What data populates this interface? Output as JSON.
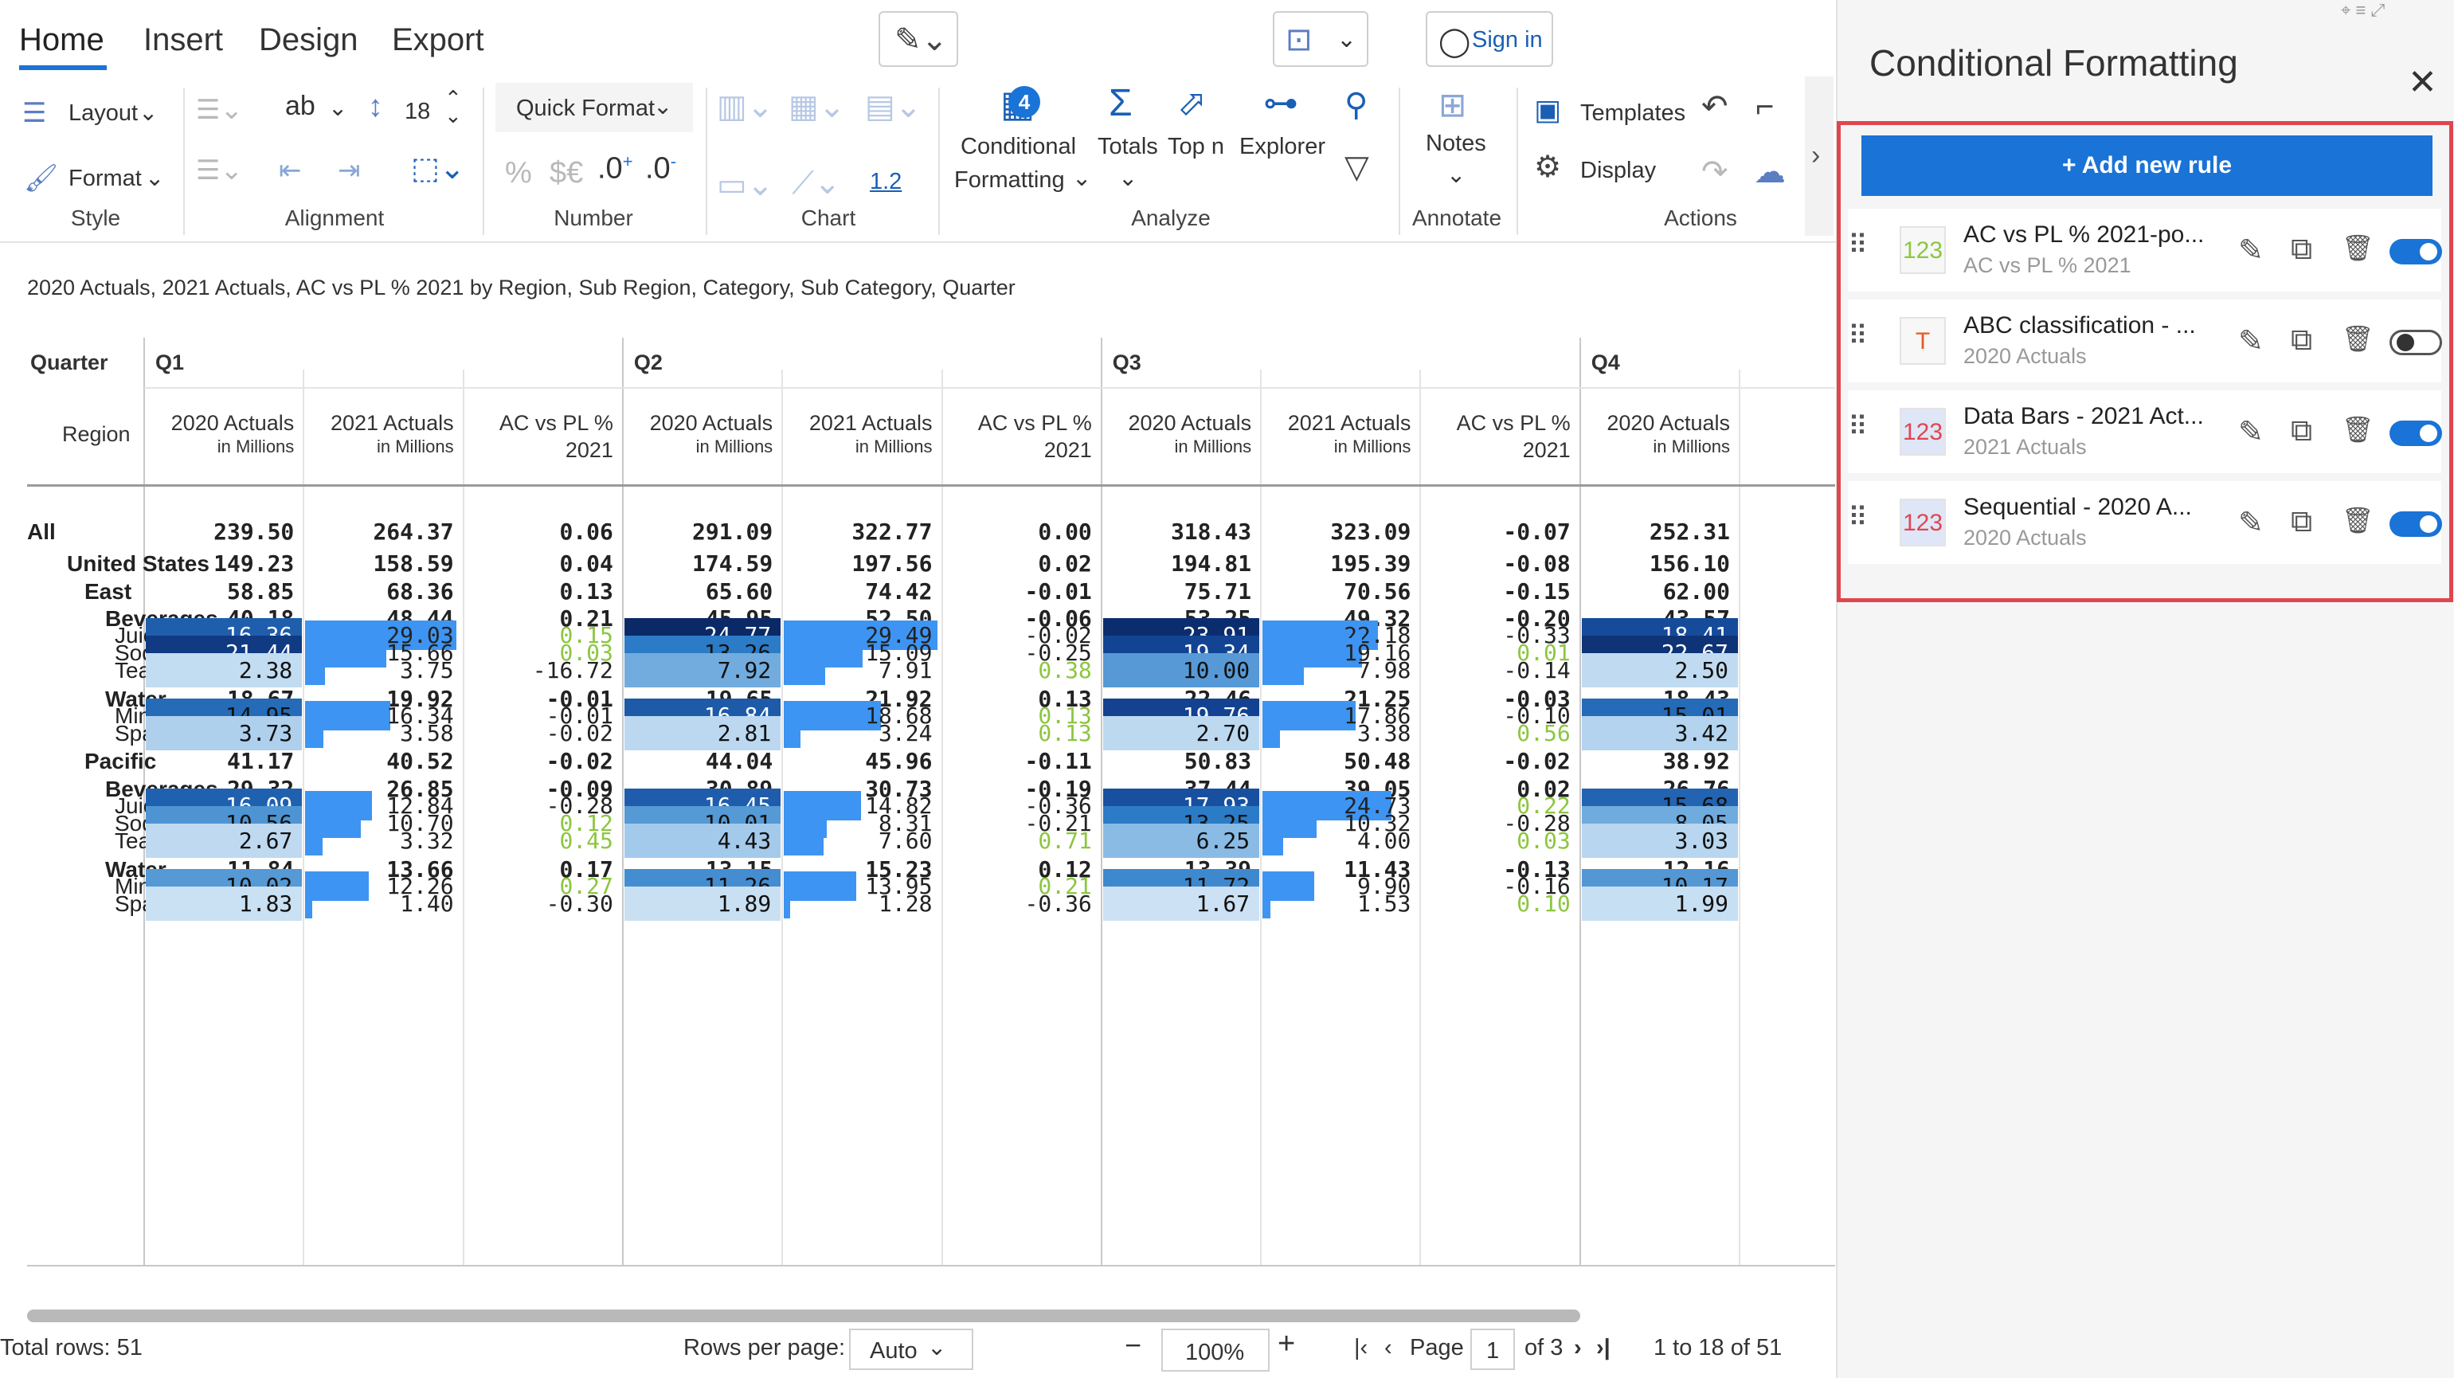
{
  "ribbon": {
    "tabs": [
      "Home",
      "Insert",
      "Design",
      "Export"
    ],
    "sign_in": "Sign in",
    "layout": "Layout",
    "format": "Format",
    "font_sample": "ab",
    "font_size": "18",
    "quick_format": "Quick Format",
    "decimal": "1.2",
    "conditional_formatting": [
      "Conditional",
      "Formatting"
    ],
    "cf_count": "4",
    "totals": "Totals",
    "topn": "Top n",
    "explorer": "Explorer",
    "notes": "Notes",
    "templates": "Templates",
    "display": "Display",
    "groups": [
      "Style",
      "Alignment",
      "Number",
      "Chart",
      "Analyze",
      "Annotate",
      "Actions"
    ]
  },
  "subtitle": "2020 Actuals, 2021 Actuals, AC vs PL % 2021 by Region, Sub Region, Category, Sub Category, Quarter",
  "table": {
    "corner_top": "Quarter",
    "corner_bottom": "Region",
    "quarters": [
      "Q1",
      "Q2",
      "Q3",
      "Q4"
    ],
    "measures": [
      [
        "2020 Actuals",
        "in Millions"
      ],
      [
        "2021 Actuals",
        "in Millions"
      ],
      [
        "AC vs PL %",
        "2021"
      ]
    ],
    "rows": [
      {
        "label": "All",
        "level": 0,
        "bold": true,
        "vals": [
          "239.50",
          "264.37",
          "0.06",
          "291.09",
          "322.77",
          "0.00",
          "318.43",
          "323.09",
          "-0.07",
          "252.31"
        ]
      },
      {
        "label": "United States",
        "level": 1,
        "bold": true,
        "vals": [
          "149.23",
          "158.59",
          "0.04",
          "174.59",
          "197.56",
          "0.02",
          "194.81",
          "195.39",
          "-0.08",
          "156.10"
        ]
      },
      {
        "label": "East",
        "level": 2,
        "bold": true,
        "vals": [
          "58.85",
          "68.36",
          "0.13",
          "65.60",
          "74.42",
          "-0.01",
          "75.71",
          "70.56",
          "-0.15",
          "62.00"
        ]
      },
      {
        "label": "Beverages",
        "level": 3,
        "bold": true,
        "vals": [
          "40.18",
          "48.44",
          "0.21",
          "45.95",
          "52.50",
          "-0.06",
          "53.25",
          "49.32",
          "-0.20",
          "43.57"
        ]
      },
      {
        "label": "Juices",
        "level": 4,
        "vals": [
          "16.36",
          "29.03",
          "0.15",
          "24.77",
          "29.49",
          "-0.02",
          "23.91",
          "22.18",
          "-0.33",
          "18.41"
        ]
      },
      {
        "label": "Soda",
        "level": 4,
        "vals": [
          "21.44",
          "15.66",
          "0.03",
          "13.26",
          "15.09",
          "-0.25",
          "19.34",
          "19.16",
          "0.01",
          "22.67"
        ]
      },
      {
        "label": "Tea & ...",
        "level": 4,
        "vals": [
          "2.38",
          "3.75",
          "-16.72",
          "7.92",
          "7.91",
          "0.38",
          "10.00",
          "7.98",
          "-0.14",
          "2.50"
        ]
      },
      {
        "label": "Water",
        "level": 3,
        "bold": true,
        "vals": [
          "18.67",
          "19.92",
          "-0.01",
          "19.65",
          "21.92",
          "0.13",
          "22.46",
          "21.25",
          "-0.03",
          "18.43"
        ]
      },
      {
        "label": "Mineral...",
        "level": 4,
        "vals": [
          "14.95",
          "16.34",
          "-0.01",
          "16.84",
          "18.68",
          "0.13",
          "19.76",
          "17.86",
          "-0.10",
          "15.01"
        ]
      },
      {
        "label": "Sparkli...",
        "level": 4,
        "vals": [
          "3.73",
          "3.58",
          "-0.02",
          "2.81",
          "3.24",
          "0.13",
          "2.70",
          "3.38",
          "0.56",
          "3.42"
        ]
      },
      {
        "label": "Pacific",
        "level": 2,
        "bold": true,
        "vals": [
          "41.17",
          "40.52",
          "-0.02",
          "44.04",
          "45.96",
          "-0.11",
          "50.83",
          "50.48",
          "-0.02",
          "38.92"
        ]
      },
      {
        "label": "Beverages",
        "level": 3,
        "bold": true,
        "vals": [
          "29.32",
          "26.85",
          "-0.09",
          "30.89",
          "30.73",
          "-0.19",
          "37.44",
          "39.05",
          "0.02",
          "26.76"
        ]
      },
      {
        "label": "Juices",
        "level": 4,
        "vals": [
          "16.09",
          "12.84",
          "-0.28",
          "16.45",
          "14.82",
          "-0.36",
          "17.93",
          "24.73",
          "0.22",
          "15.68"
        ]
      },
      {
        "label": "Soda",
        "level": 4,
        "vals": [
          "10.56",
          "10.70",
          "0.12",
          "10.01",
          "8.31",
          "-0.21",
          "13.25",
          "10.32",
          "-0.28",
          "8.05"
        ]
      },
      {
        "label": "Tea & ...",
        "level": 4,
        "vals": [
          "2.67",
          "3.32",
          "0.45",
          "4.43",
          "7.60",
          "0.71",
          "6.25",
          "4.00",
          "0.03",
          "3.03"
        ]
      },
      {
        "label": "Water",
        "level": 3,
        "bold": true,
        "vals": [
          "11.84",
          "13.66",
          "0.17",
          "13.15",
          "15.23",
          "0.12",
          "13.39",
          "11.43",
          "-0.13",
          "12.16"
        ]
      },
      {
        "label": "Mineral...",
        "level": 4,
        "vals": [
          "10.02",
          "12.26",
          "0.27",
          "11.26",
          "13.95",
          "0.21",
          "11.72",
          "9.90",
          "-0.16",
          "10.17"
        ]
      },
      {
        "label": "Sparkli...",
        "level": 4,
        "vals": [
          "1.83",
          "1.40",
          "-0.30",
          "1.89",
          "1.28",
          "-0.36",
          "1.67",
          "1.53",
          "0.10",
          "1.99"
        ]
      }
    ]
  },
  "footer": {
    "total_rows": "Total rows: 51",
    "rows_per_page_label": "Rows per page:",
    "rows_per_page": "Auto",
    "zoom": "100%",
    "page_label": "Page",
    "page": "1",
    "of_pages": "of 3",
    "range": "1 to 18 of 51"
  },
  "panel": {
    "title": "Conditional Formatting",
    "add_rule": "+ Add new rule",
    "rules": [
      {
        "badge": "123",
        "badge_color": "#8cc63f",
        "name": "AC vs PL % 2021-po...",
        "sub": "AC vs PL % 2021",
        "on": true
      },
      {
        "badge": "T",
        "badge_color": "#e85a1f",
        "name": "ABC classification - ...",
        "sub": "2020 Actuals",
        "on": false
      },
      {
        "badge": "123",
        "badge_color": "#e0464e",
        "name": "Data Bars - 2021 Act...",
        "sub": "2021 Actuals",
        "on": true
      },
      {
        "badge": "123",
        "badge_color": "#e0464e",
        "name": "Sequential - 2020 A...",
        "sub": "2020 Actuals",
        "on": true
      }
    ]
  },
  "colors": {
    "accent": "#1a73d6",
    "bar": "#3d94f2",
    "positive": "#8cc63f",
    "highlight_border": "#e0464e"
  }
}
